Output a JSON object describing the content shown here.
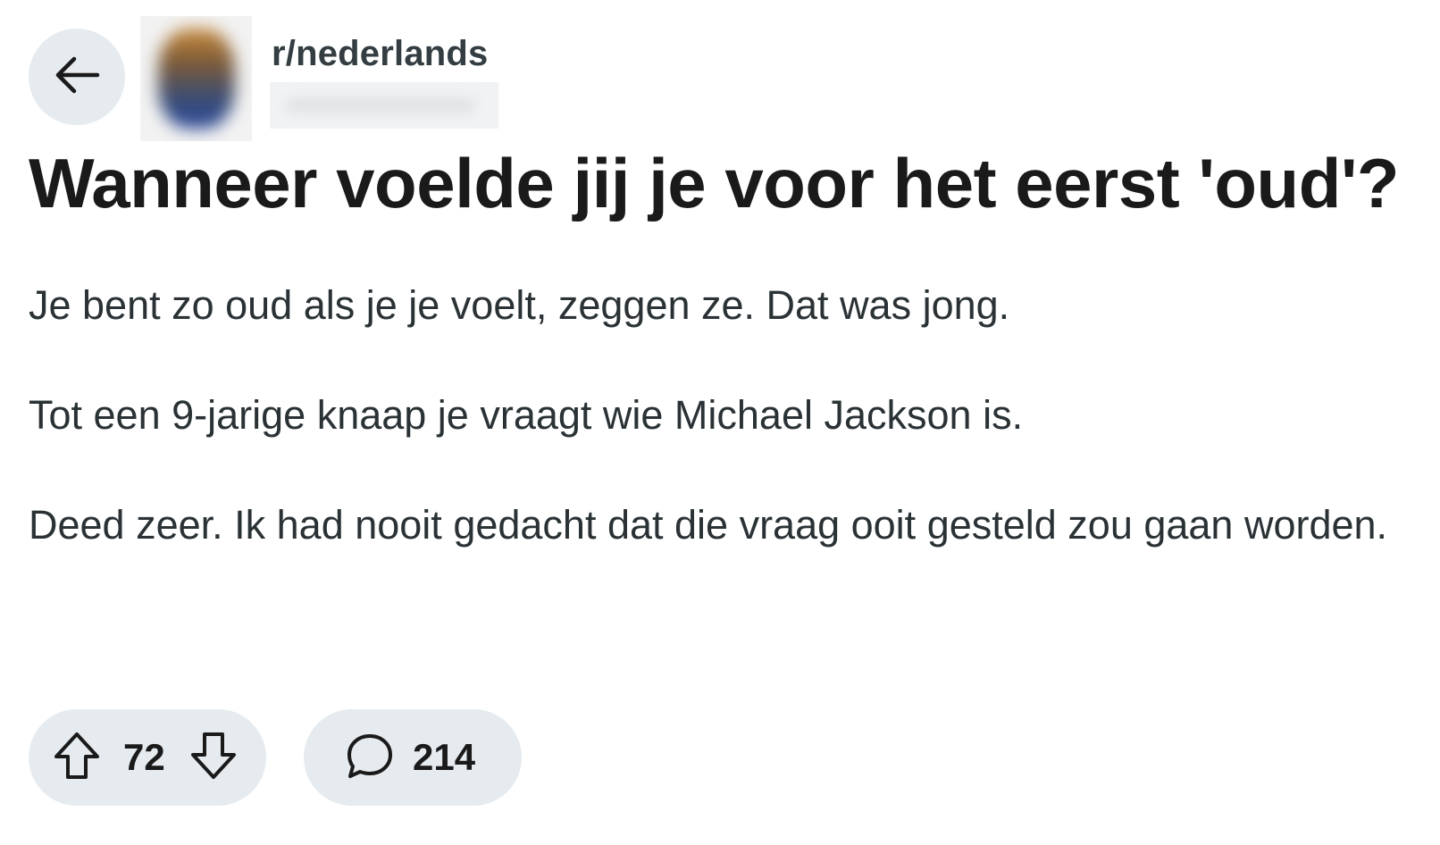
{
  "header": {
    "back_icon": "arrow-left-icon",
    "subreddit": "r/nederlands"
  },
  "post": {
    "title": "Wanneer voelde jij je voor het eerst 'oud'?",
    "paragraphs": [
      "Je bent zo oud als je je voelt, zeggen ze. Dat was jong.",
      "Tot een 9-jarige knaap je vraagt wie Michael Jackson is.",
      "Deed zeer. Ik had nooit gedacht dat die vraag ooit gesteld zou gaan worden."
    ]
  },
  "actions": {
    "upvote_icon": "arrow-up-icon",
    "downvote_icon": "arrow-down-icon",
    "vote_count": "72",
    "comment_icon": "comment-bubble-icon",
    "comment_count": "214"
  },
  "colors": {
    "pill_background": "#e5ebee",
    "title_text": "#1a1a1b",
    "body_text": "#2a3236"
  }
}
